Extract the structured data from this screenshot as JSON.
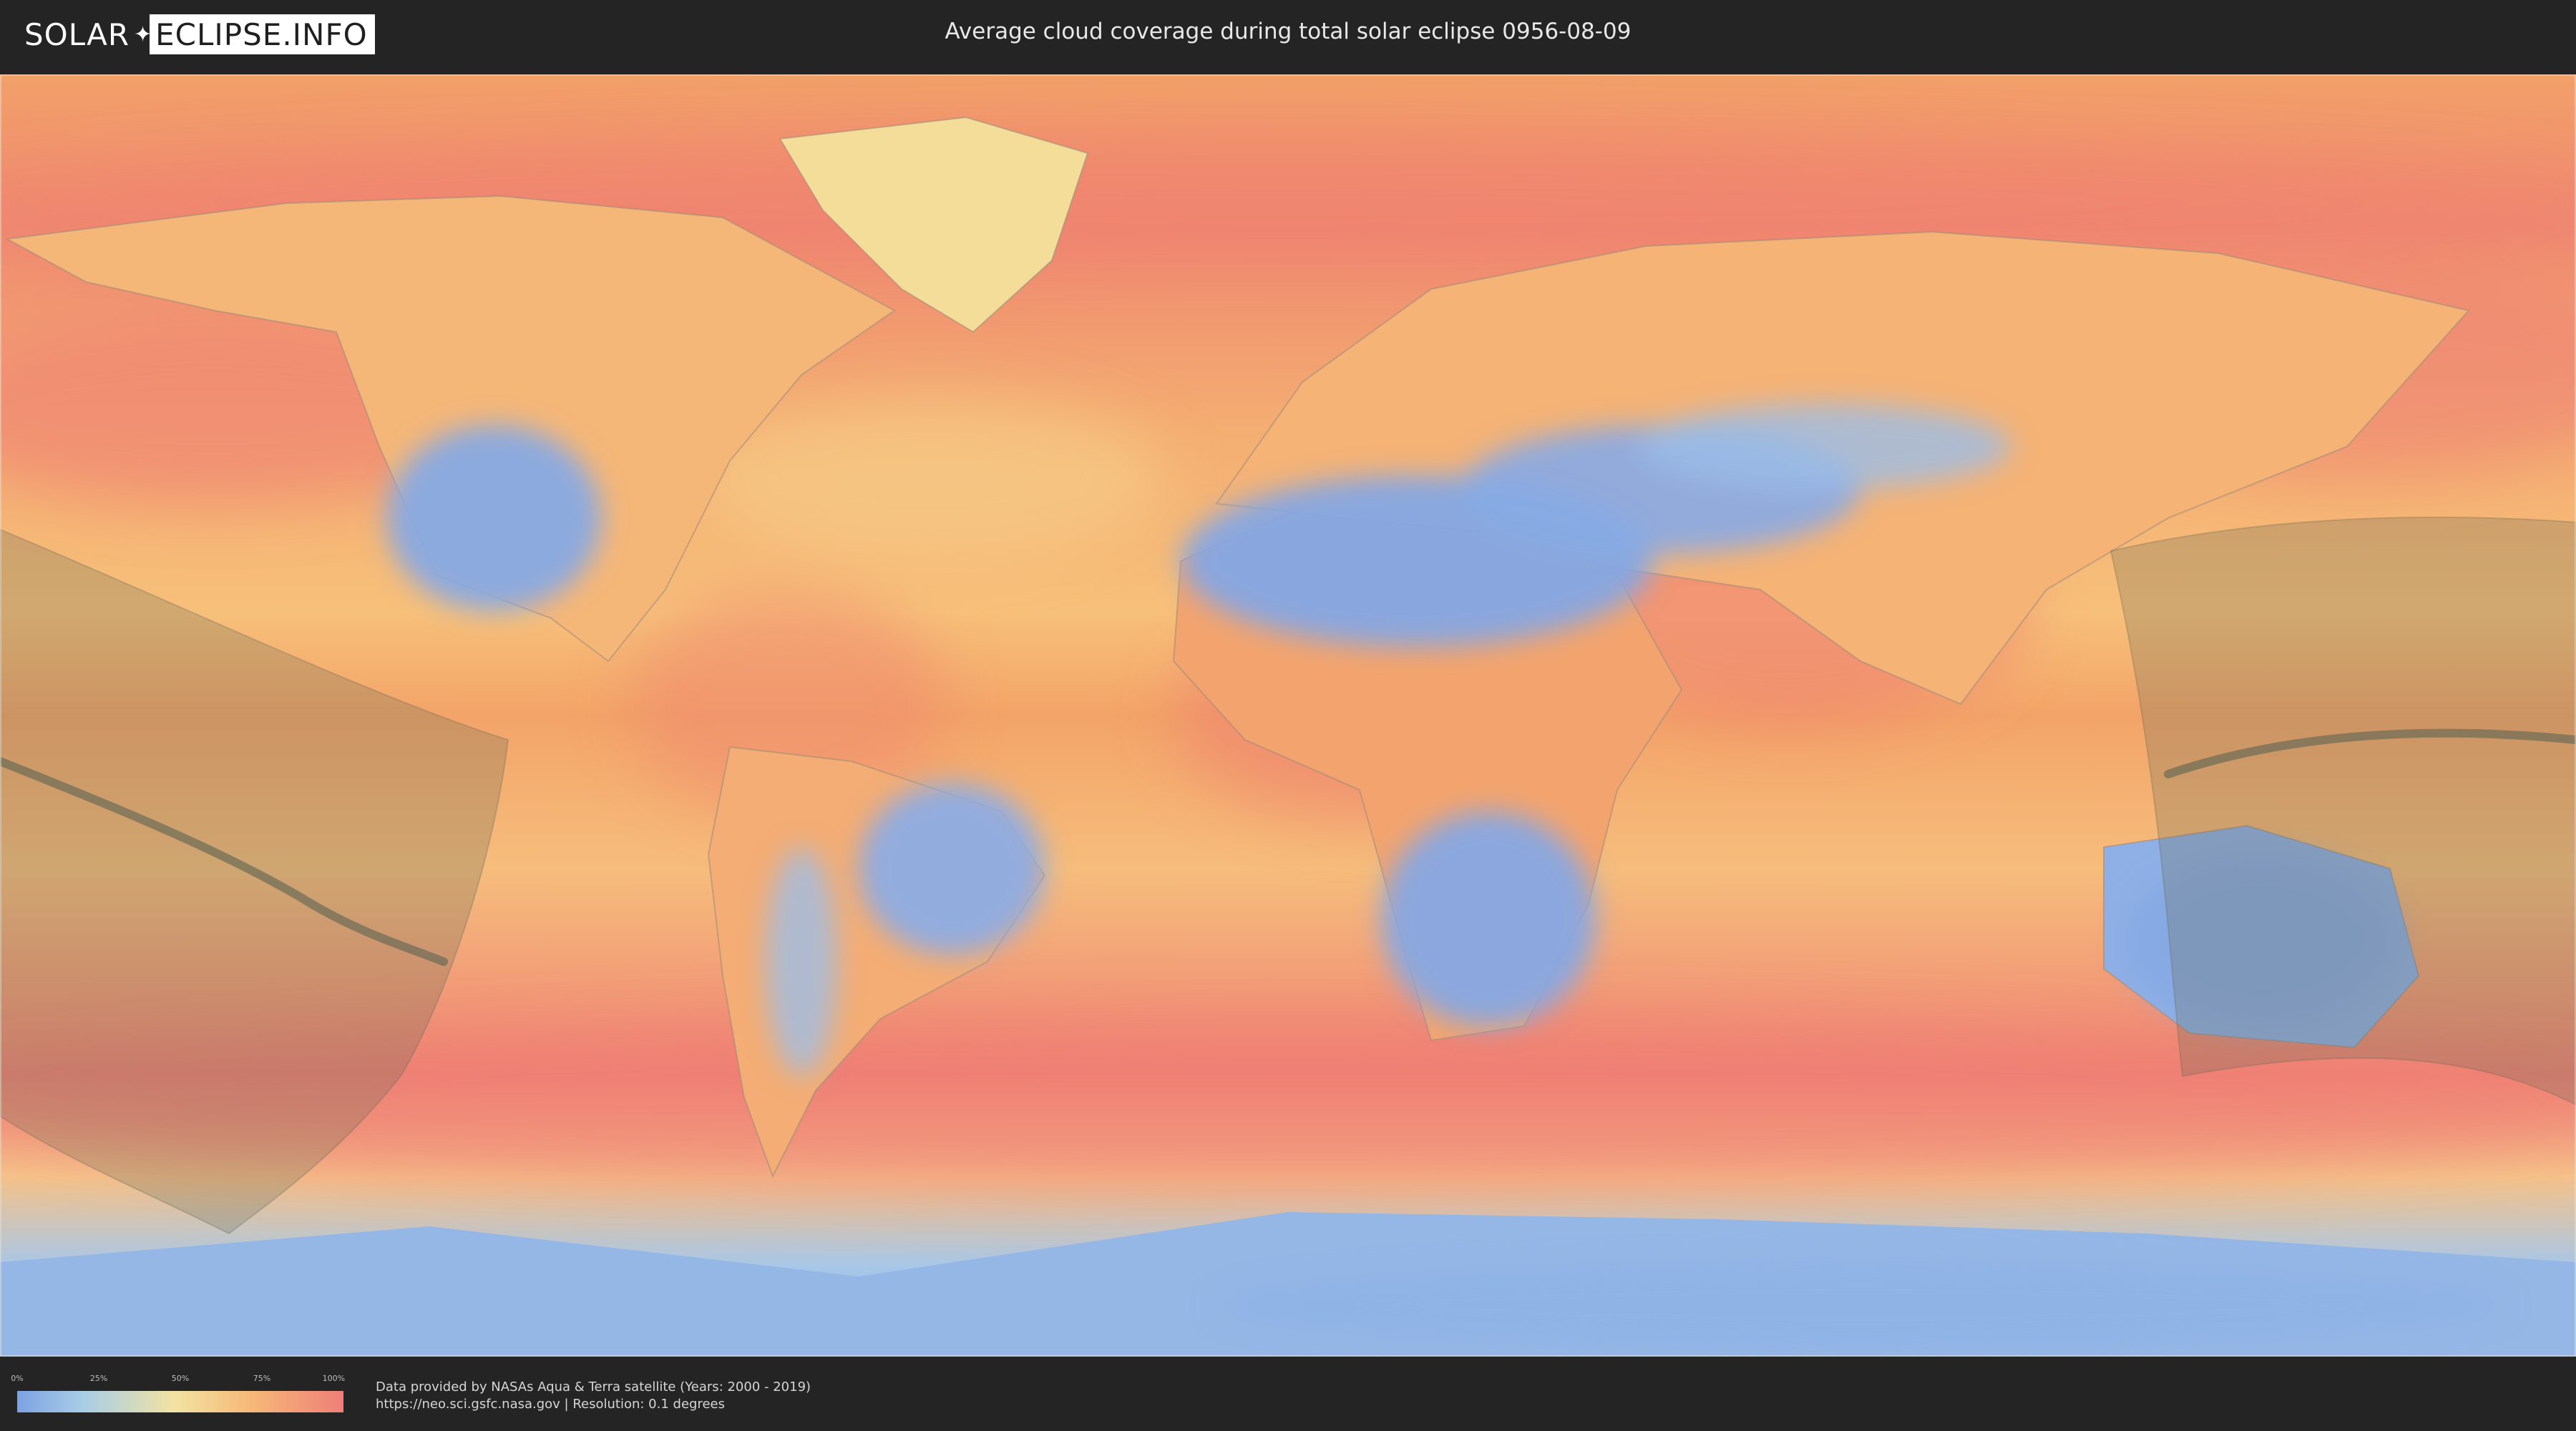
{
  "header": {
    "logo_left": "SOLAR",
    "logo_right": "ECLIPSE.INFO",
    "title": "Average cloud coverage during total solar eclipse 0956-08-09"
  },
  "legend": {
    "ticks": [
      "0%",
      "25%",
      "50%",
      "75%",
      "100%"
    ],
    "scale_colors": [
      "#7da2e2",
      "#a8cde6",
      "#f2e3a2",
      "#f6b878",
      "#ef7f78"
    ]
  },
  "credits": {
    "line1": "Data provided by NASAs Aqua & Terra satellite (Years: 2000 - 2019)",
    "line2": "https://neo.sci.gsfc.nasa.gov | Resolution: 0.1 degrees"
  },
  "colors": {
    "clear": "#7da2e2",
    "overcast": "#ef7f78",
    "eclipse_path": "#6b6b55"
  }
}
